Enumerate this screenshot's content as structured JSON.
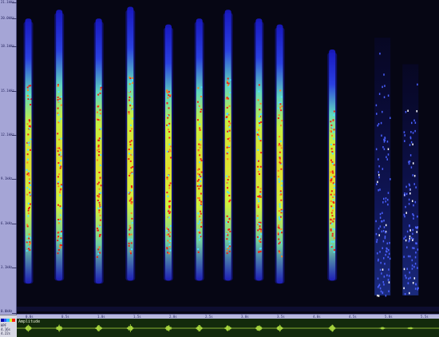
{
  "frequency_axis": {
    "labels": [
      "21.1kHz",
      "20.0kHz",
      "18.1kHz",
      "15.1kHz",
      "12.1kHz",
      "9.1kHz",
      "6.1kHz",
      "3.1kHz",
      "0.0kHz"
    ],
    "values_khz": [
      21.1,
      20.0,
      18.1,
      15.1,
      12.1,
      9.1,
      6.1,
      3.1,
      0.0
    ]
  },
  "time_axis": {
    "labels": [
      "0.0s",
      "0.5s",
      "1.0s",
      "1.5s",
      "2.0s",
      "2.5s",
      "3.0s",
      "3.5s",
      "4.0s",
      "4.5s",
      "5.0s",
      "5.5s"
    ]
  },
  "waveform": {
    "title": "Amplitude"
  },
  "side_panel": {
    "labels": [
      "HPF",
      "4.16s",
      "4.22s"
    ],
    "scale_colors": [
      "#0000aa",
      "#3060ff",
      "#30c0ff",
      "#c8ff30",
      "#ff2010"
    ]
  },
  "colors": {
    "background": "#060614",
    "axis_panel": "#a5a5d6",
    "waveform_bg": "#132a0c",
    "waveform_trace": "#b0e040"
  },
  "bursts": [
    {
      "time_s": 0.05,
      "low_khz": 2.0,
      "high_khz": 20.0
    },
    {
      "time_s": 0.48,
      "low_khz": 2.2,
      "high_khz": 20.6
    },
    {
      "time_s": 1.03,
      "low_khz": 2.0,
      "high_khz": 20.0
    },
    {
      "time_s": 1.47,
      "low_khz": 2.2,
      "high_khz": 20.8
    },
    {
      "time_s": 2.0,
      "low_khz": 2.2,
      "high_khz": 19.6
    },
    {
      "time_s": 2.43,
      "low_khz": 2.2,
      "high_khz": 20.0
    },
    {
      "time_s": 2.83,
      "low_khz": 2.2,
      "high_khz": 20.6
    },
    {
      "time_s": 3.26,
      "low_khz": 2.2,
      "high_khz": 20.0
    },
    {
      "time_s": 3.55,
      "low_khz": 2.0,
      "high_khz": 19.6
    },
    {
      "time_s": 4.28,
      "low_khz": 2.2,
      "high_khz": 17.9
    },
    {
      "time_s": 4.98,
      "low_khz": 1.2,
      "high_khz": 18.7,
      "diffuse": true
    },
    {
      "time_s": 5.37,
      "low_khz": 1.2,
      "high_khz": 16.9,
      "diffuse": true
    }
  ]
}
